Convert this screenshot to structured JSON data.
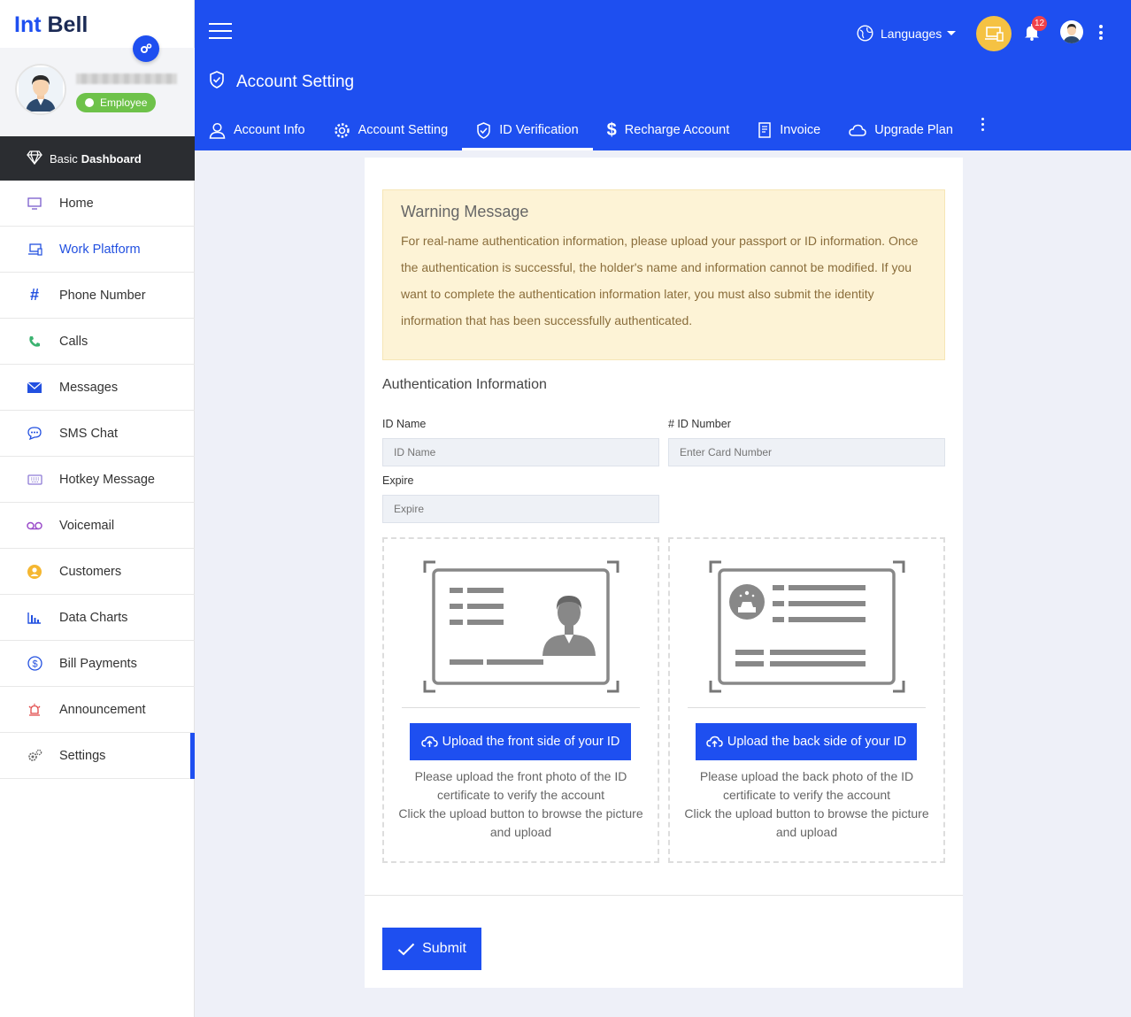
{
  "brand": {
    "part1": "Int",
    "part2": "Bell"
  },
  "profile": {
    "role": "Employee"
  },
  "sidebar": {
    "dashboard": {
      "prefix": "Basic",
      "title": "Dashboard"
    },
    "items": [
      {
        "label": "Home",
        "icon": "monitor-icon"
      },
      {
        "label": "Work Platform",
        "icon": "devices-icon"
      },
      {
        "label": "Phone Number",
        "icon": "hash-icon"
      },
      {
        "label": "Calls",
        "icon": "phone-icon"
      },
      {
        "label": "Messages",
        "icon": "envelope-icon"
      },
      {
        "label": "SMS Chat",
        "icon": "chat-icon"
      },
      {
        "label": "Hotkey Message",
        "icon": "keyboard-icon"
      },
      {
        "label": "Voicemail",
        "icon": "voicemail-icon"
      },
      {
        "label": "Customers",
        "icon": "user-circle-icon"
      },
      {
        "label": "Data Charts",
        "icon": "bar-chart-icon"
      },
      {
        "label": "Bill Payments",
        "icon": "dollar-icon"
      },
      {
        "label": "Announcement",
        "icon": "alarm-icon"
      },
      {
        "label": "Settings",
        "icon": "gears-icon"
      }
    ]
  },
  "header": {
    "languages": "Languages",
    "notification_count": "12",
    "page_title": "Account Setting",
    "tabs": [
      {
        "label": "Account Info",
        "icon": "user-icon"
      },
      {
        "label": "Account Setting",
        "icon": "gear-icon"
      },
      {
        "label": "ID Verification",
        "icon": "shield-check-icon"
      },
      {
        "label": "Recharge Account",
        "icon": "dollar-sign-icon"
      },
      {
        "label": "Invoice",
        "icon": "invoice-icon"
      },
      {
        "label": "Upgrade Plan",
        "icon": "cloud-icon"
      }
    ]
  },
  "warning": {
    "title": "Warning Message",
    "text": "For real-name authentication information, please upload your passport or ID information. Once the authentication is successful, the holder's name and information cannot be modified. If you want to complete the authentication information later, you must also submit the identity information that has been successfully authenticated."
  },
  "form": {
    "section_title": "Authentication Information",
    "id_name": {
      "label": "ID Name",
      "placeholder": "ID Name"
    },
    "id_number": {
      "label": "# ID Number",
      "placeholder": "Enter Card Number"
    },
    "expire": {
      "label": "Expire",
      "placeholder": "Expire"
    }
  },
  "upload": {
    "front": {
      "button": "Upload the front side of your ID",
      "line1": "Please upload the front photo of the ID certificate to verify the account",
      "line2": "Click the upload button to browse the picture and upload"
    },
    "back": {
      "button": "Upload the back side of your ID",
      "line1": "Please upload the back photo of the ID certificate to verify the account",
      "line2": "Click the upload button to browse the picture and upload"
    }
  },
  "submit_label": "Submit",
  "colors": {
    "primary": "#1e4ff0",
    "warning_bg": "#fdf3d6",
    "badge": "#6ec24a",
    "notification": "#f0414a"
  }
}
